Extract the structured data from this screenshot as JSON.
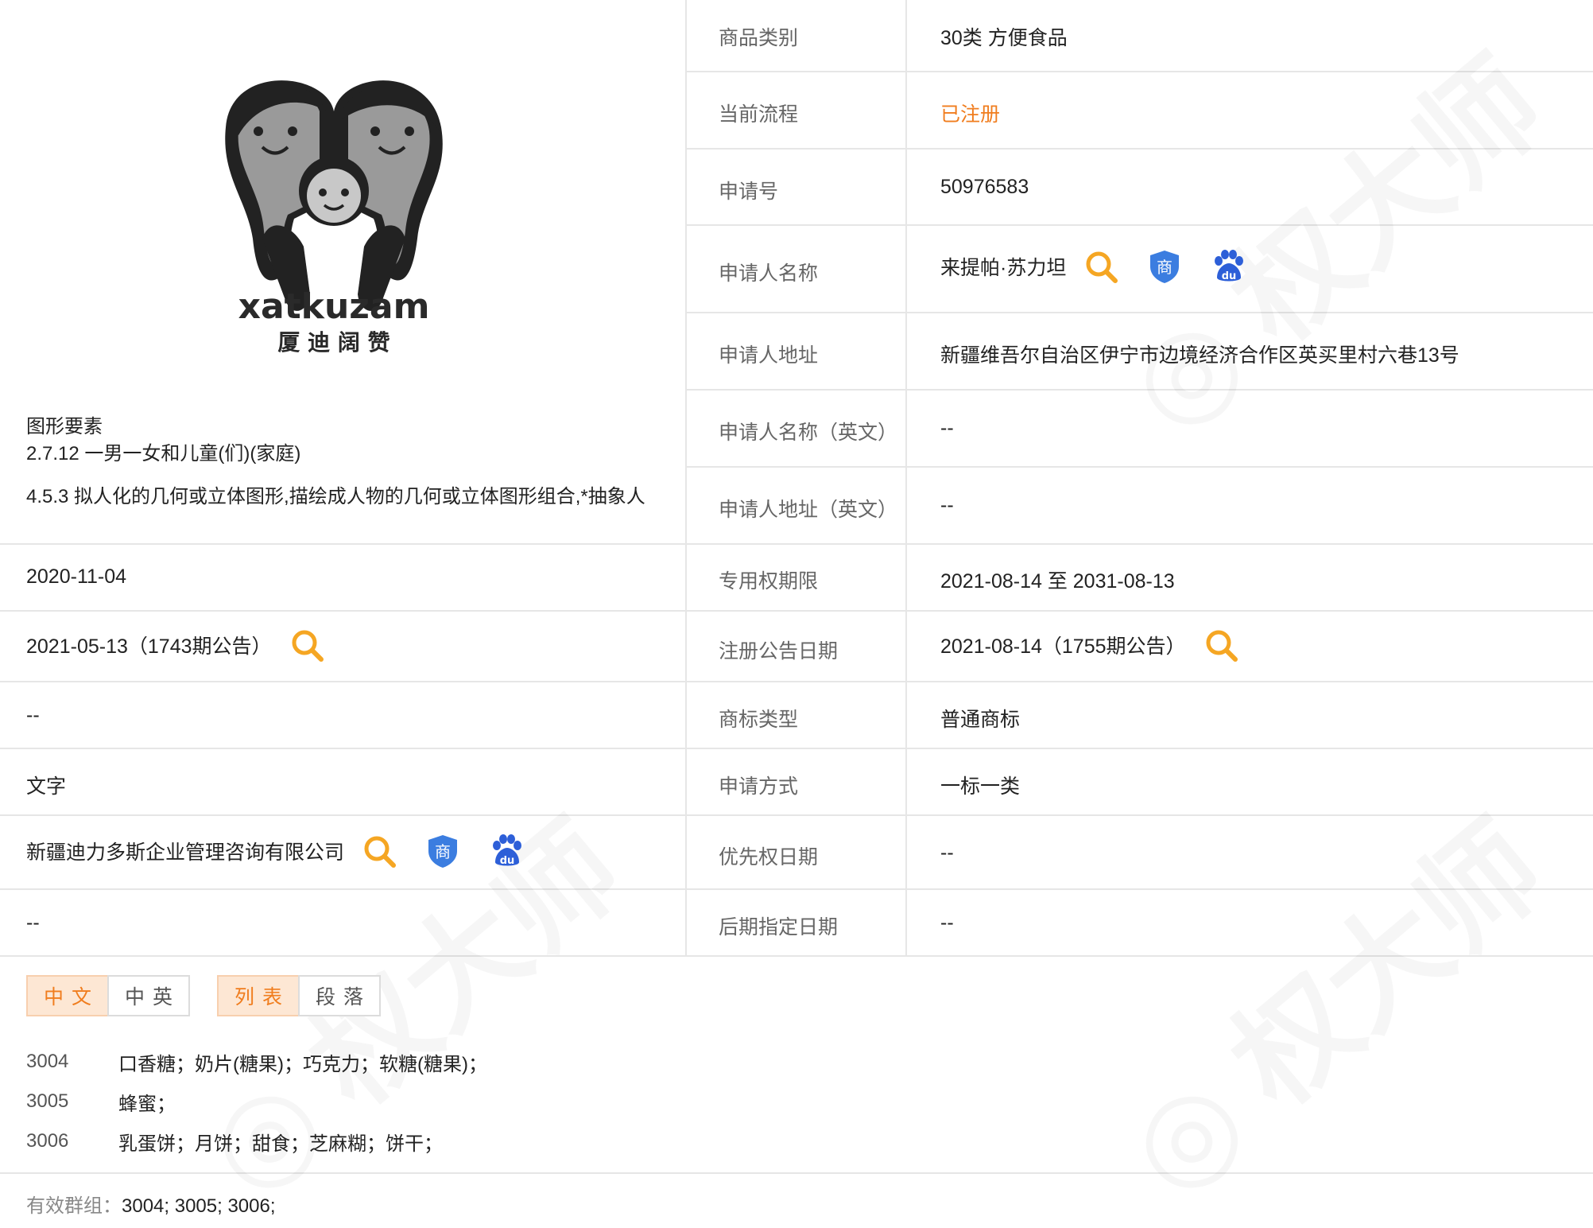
{
  "logo": {
    "brand_text": "xatkuzam",
    "brand_cn": "厦 迪 阔 赞"
  },
  "figure_elements": {
    "title": "图形要素",
    "items": [
      "2.7.12 一男一女和儿童(们)(家庭)",
      "4.5.3 拟人化的几何或立体图形,描绘成人物的几何或立体图形组合,*抽象人"
    ]
  },
  "left_values": {
    "application_date": "2020-11-04",
    "preliminary_notice": "2021-05-13（1743期公告）",
    "row3": "--",
    "mark_form": "文字",
    "agent": "新疆迪力多斯企业管理咨询有限公司",
    "row6": "--"
  },
  "fields": {
    "category": {
      "label": "商品类别",
      "value": "30类 方便食品"
    },
    "process": {
      "label": "当前流程",
      "value": "已注册"
    },
    "app_no": {
      "label": "申请号",
      "value": "50976583"
    },
    "applicant": {
      "label": "申请人名称",
      "value": "来提帕·苏力坦"
    },
    "address": {
      "label": "申请人地址",
      "value": "新疆维吾尔自治区伊宁市边境经济合作区英买里村六巷13号"
    },
    "applicant_en": {
      "label": "申请人名称（英文）",
      "value": "--"
    },
    "address_en": {
      "label": "申请人地址（英文）",
      "value": "--"
    },
    "term": {
      "label": "专用权期限",
      "value": "2021-08-14 至 2031-08-13"
    },
    "reg_notice": {
      "label": "注册公告日期",
      "value": "2021-08-14（1755期公告）"
    },
    "mark_type": {
      "label": "商标类型",
      "value": "普通商标"
    },
    "apply_method": {
      "label": "申请方式",
      "value": "一标一类"
    },
    "priority": {
      "label": "优先权日期",
      "value": "--"
    },
    "later_date": {
      "label": "后期指定日期",
      "value": "--"
    }
  },
  "tabs": {
    "lang": [
      "中文",
      "中英"
    ],
    "view": [
      "列表",
      "段落"
    ]
  },
  "goods": [
    {
      "code": "3004",
      "text": "口香糖；奶片(糖果)；巧克力；软糖(糖果)；"
    },
    {
      "code": "3005",
      "text": "蜂蜜；"
    },
    {
      "code": "3006",
      "text": "乳蛋饼；月饼；甜食；芝麻糊；饼干；"
    }
  ],
  "groups": {
    "label": "有效群组：",
    "value": "3004;   3005;   3006;"
  },
  "colors": {
    "accent": "#f07d1e",
    "shield_blue": "#3b7de0",
    "baidu_blue": "#2d5fd8"
  }
}
